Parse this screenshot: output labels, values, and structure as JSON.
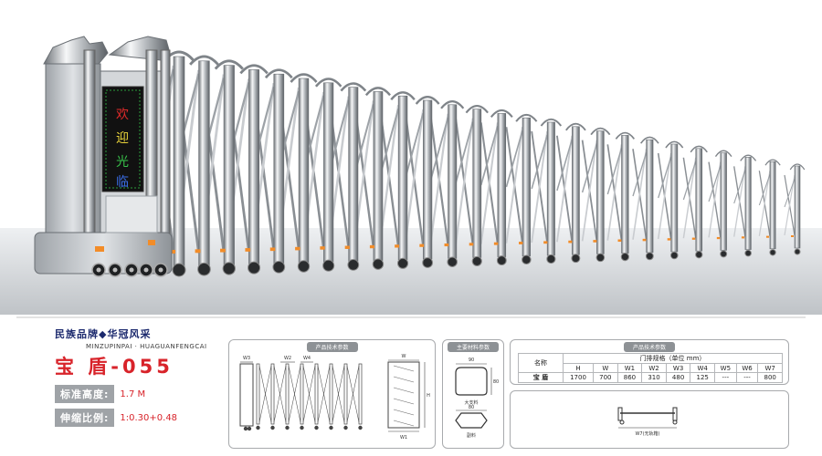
{
  "display_sign": {
    "chars": [
      "欢",
      "迎",
      "光",
      "临"
    ]
  },
  "brand": {
    "title": "民族品牌◆华冠风采",
    "subtitle": "MINZUPINPAI · HUAGUANFENGCAI",
    "model": "宝 盾-055"
  },
  "specs": [
    {
      "label": "标准高度:",
      "value": "1.7 M"
    },
    {
      "label": "伸缩比例:",
      "value": "1:0.30+0.48"
    }
  ],
  "drawing_panel": {
    "header": "产品技术参数",
    "dims": {
      "w3": "W3",
      "w2": "W2",
      "w4": "W4",
      "w": "W",
      "h": "H",
      "w1": "W1"
    }
  },
  "material_panel": {
    "header": "主要材料参数",
    "labels": {
      "top_width": "90",
      "top_height": "80",
      "top_name": "大支料",
      "bottom_width": "80",
      "bottom_name": "副料"
    }
  },
  "table_panel": {
    "header": "产品技术参数",
    "name_header": "名称",
    "spec_header": "门排规格（单位 mm）",
    "columns": [
      "H",
      "W",
      "W1",
      "W2",
      "W3",
      "W4",
      "W5",
      "W6",
      "W7"
    ],
    "row_name": "宝 盾",
    "values": [
      "1700",
      "700",
      "860",
      "310",
      "480",
      "125",
      "---",
      "---",
      "800"
    ]
  },
  "track_panel": {
    "label": "W7(无轨箱)"
  },
  "colors": {
    "accent_red": "#d8232a",
    "navy": "#1c2a6e",
    "panel_grey": "#8d9195"
  }
}
